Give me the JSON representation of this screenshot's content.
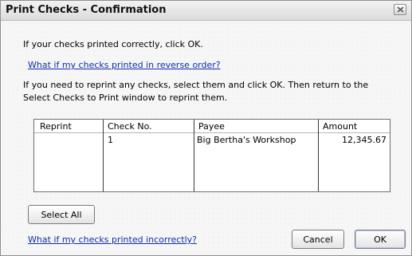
{
  "window": {
    "title": "Print Checks - Confirmation"
  },
  "instructions": {
    "printed_correctly": "If your checks printed correctly, click OK.",
    "reverse_order_link": "What if my checks printed in reverse order?",
    "reprint_text": "If you need to reprint any checks, select them and click OK. Then return to the Select Checks to Print window to reprint them."
  },
  "table": {
    "headers": {
      "reprint": "Reprint",
      "check_no": "Check No.",
      "payee": "Payee",
      "amount": "Amount"
    },
    "rows": [
      {
        "reprint": "",
        "check_no": "1",
        "payee": "Big Bertha's Workshop",
        "amount": "12,345.67"
      }
    ]
  },
  "buttons": {
    "select_all": "Select All",
    "cancel": "Cancel",
    "ok": "OK"
  },
  "footer": {
    "incorrect_link": "What if my checks printed incorrectly?"
  }
}
